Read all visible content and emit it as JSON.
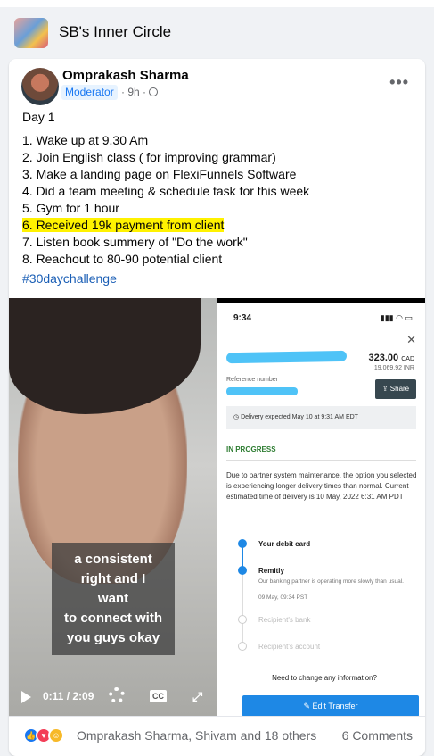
{
  "group": {
    "name": "SB's Inner Circle"
  },
  "post": {
    "author": "Omprakash Sharma",
    "badge": "Moderator",
    "time": "· 9h ·",
    "lines": [
      "Day 1",
      "1. Wake up at 9.30 Am",
      "2. Join English class ( for improving grammar)",
      "3. Make a landing page on FlexiFunnels Software",
      "4. Did a team meeting & schedule task for this week",
      "5. Gym for 1 hour",
      "6. Received 19k payment from client",
      "7. Listen book summery of \"Do the work\"",
      "8. Reachout to 80-90 potential client"
    ],
    "hashtag": "#30daychallenge"
  },
  "video": {
    "caption_lines": [
      "a consistent",
      "right and I",
      "want",
      "to connect with",
      "you guys okay"
    ],
    "time": "0:11 / 2:09",
    "cc_label": "CC"
  },
  "phone": {
    "time": "9:34",
    "amount": "323.00",
    "currency": "CAD",
    "inr": "19,069.92 INR",
    "reference_label": "Reference number",
    "share_label": "Share",
    "delivery": "Delivery expected May 10 at 9:31 AM EDT",
    "status": "IN PROGRESS",
    "notice": "Due to partner system maintenance, the option you selected is experiencing longer delivery times than normal. Current estimated time of delivery is 10 May, 2022 6:31 AM PDT",
    "steps": [
      {
        "label": "Your debit card"
      },
      {
        "label": "Remitly",
        "sub": "Our banking partner is operating more slowly than usual.",
        "time": "09 May, 09:34 PST"
      },
      {
        "label": "Recipient's bank"
      },
      {
        "label": "Recipient's account"
      }
    ],
    "help_text": "Need to change any information?",
    "edit_button": "✎ Edit Transfer"
  },
  "footer": {
    "reactions_text": "Omprakash Sharma, Shivam and 18 others",
    "comments_text": "6 Comments"
  }
}
